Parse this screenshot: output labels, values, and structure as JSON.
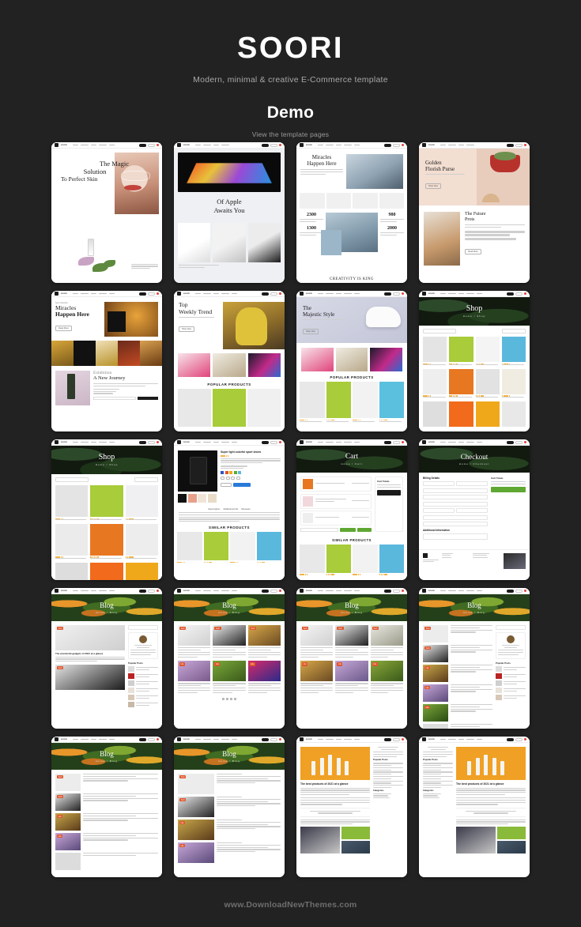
{
  "header": {
    "brand": "SOORI",
    "tagline": "Modern, minimal & creative E-Commerce template",
    "demo_title": "Demo",
    "demo_sub": "View the template pages"
  },
  "footer": {
    "credit": "www.DownloadNewThemes.com"
  },
  "colors": {
    "background": "#222222",
    "brand_text": "#ffffff",
    "tagline_text": "#a8a8a8",
    "credit_text": "#6e6e6e",
    "accent_green": "#5fa832",
    "accent_orange": "#e0562c",
    "accent_star": "#f0a82a",
    "badge_red": "#e0453c"
  },
  "thumbnails": [
    {
      "id": "home-cosmetics",
      "title_lines": [
        "The Magic",
        "Solution",
        "To Perfect Skin"
      ],
      "nav_brand": "SOORI"
    },
    {
      "id": "home-apple",
      "title_lines": [
        "Of Apple",
        "Awaits You"
      ],
      "nav_brand": "SOORI"
    },
    {
      "id": "home-miracles",
      "title_lines": [
        "Miracles",
        "Happen Here"
      ],
      "nav_brand": "SOORI",
      "stats": [
        {
          "value": "2300",
          "label": "Happy Clients"
        },
        {
          "value": "1300",
          "label": "Projects Done"
        },
        {
          "value": "980",
          "label": "Awards Won"
        },
        {
          "value": "2000",
          "label": "Cups Of Coffee"
        }
      ],
      "footer_text": "CREATIVITY IS KING"
    },
    {
      "id": "home-purse",
      "title_lines": [
        "Golden",
        "Florish Purse"
      ],
      "sub_title_lines": [
        "The Future",
        "Prots"
      ],
      "nav_brand": "SOORI",
      "cta": "Shop Now"
    },
    {
      "id": "home-drinks",
      "title_lines": [
        "Miracles",
        "Happen Here"
      ],
      "sub_title_lines": [
        "Exhibition",
        "A New Journey"
      ],
      "nav_brand": "SOORI",
      "cta": "Read More"
    },
    {
      "id": "home-weekly",
      "title_lines": [
        "Top",
        "Weekly Trend"
      ],
      "section_label": "POPULAR PRODUCTS",
      "nav_brand": "SOORI",
      "cta": "Shop Now"
    },
    {
      "id": "home-majestic",
      "title_lines": [
        "The",
        "Majestic Style"
      ],
      "section_label": "POPULAR PRODUCTS",
      "nav_brand": "SOORI",
      "cta": "Shop Now"
    },
    {
      "id": "shop-grid-4col",
      "page_title": "Shop",
      "breadcrumb": "Home / Shop",
      "nav_brand": "SOORI"
    },
    {
      "id": "shop-grid-3col",
      "page_title": "Shop",
      "breadcrumb": "Home / Shop",
      "nav_brand": "SOORI"
    },
    {
      "id": "product-detail",
      "product_title": "Super light colorful sport shoes",
      "section_label": "SIMILAR PRODUCTS",
      "nav_brand": "SOORI"
    },
    {
      "id": "cart",
      "page_title": "Cart",
      "breadcrumb": "Home / Cart",
      "section_label": "SIMILAR PRODUCTS",
      "summary_title": "Cart Totals",
      "checkout_button": "Proceed To Checkout",
      "nav_brand": "SOORI"
    },
    {
      "id": "checkout",
      "page_title": "Checkout",
      "breadcrumb": "Home / Checkout",
      "form_title": "Billing Details",
      "summary_title": "Cart Totals",
      "place_order_button": "Place Order",
      "nav_brand": "SOORI"
    },
    {
      "id": "blog-sidebar",
      "page_title": "Blog",
      "breadcrumb": "Home / Blog",
      "nav_brand": "SOORI"
    },
    {
      "id": "blog-grid",
      "page_title": "Blog",
      "breadcrumb": "Home / Blog",
      "nav_brand": "SOORI"
    },
    {
      "id": "blog-masonry",
      "page_title": "Blog",
      "breadcrumb": "Home / Blog",
      "nav_brand": "SOORI"
    },
    {
      "id": "blog-list",
      "page_title": "Blog",
      "breadcrumb": "Home / Blog",
      "nav_brand": "SOORI"
    },
    {
      "id": "blog-list-left",
      "page_title": "Blog",
      "breadcrumb": "Home / Blog",
      "nav_brand": "SOORI"
    },
    {
      "id": "blog-list-wide",
      "page_title": "Blog",
      "breadcrumb": "Home / Blog",
      "nav_brand": "SOORI"
    },
    {
      "id": "blog-single-right-sidebar",
      "post_title": "The best products of 2021 at a glance",
      "nav_brand": "SOORI"
    },
    {
      "id": "blog-single-left-sidebar",
      "post_title": "The best products of 2021 at a glance",
      "nav_brand": "SOORI"
    }
  ],
  "grid": {
    "rows": 5,
    "columns": 4,
    "total": 20
  }
}
